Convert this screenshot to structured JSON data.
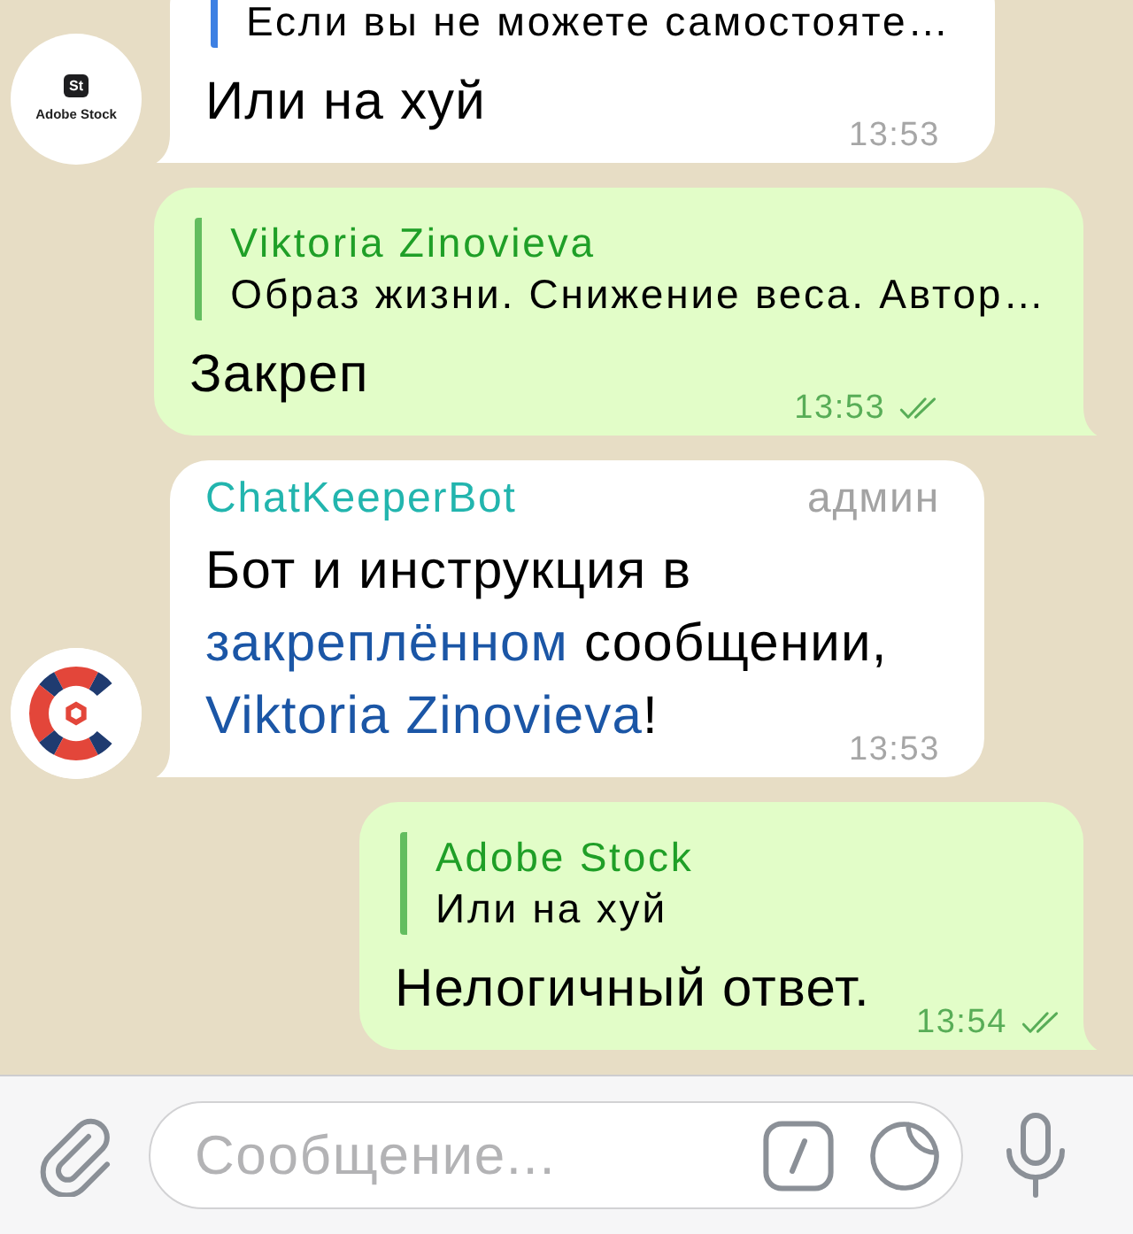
{
  "messages": [
    {
      "kind": "incoming",
      "avatar": {
        "kind": "badge",
        "badge": "St",
        "caption": "Adobe Stock"
      },
      "reply": {
        "text": "Если вы не можете самостояте…"
      },
      "text": [
        {
          "kind": "plain",
          "text": "Или на хуй"
        }
      ],
      "time": "13:53"
    },
    {
      "kind": "outgoing",
      "reply": {
        "name": "Viktoria Zinovieva",
        "text": "Образ жизни. Снижение веса. Автор…"
      },
      "text": [
        {
          "kind": "plain",
          "text": "Закреп"
        }
      ],
      "time": "13:53",
      "read": true
    },
    {
      "kind": "incoming",
      "avatar": {
        "kind": "ring"
      },
      "sender": {
        "name": "ChatKeeperBot",
        "color": "#22b5ae"
      },
      "role": "админ",
      "text": [
        {
          "kind": "plain",
          "text": "Бот и инструкция в "
        },
        {
          "kind": "link",
          "text": "закреплённом"
        },
        {
          "kind": "plain",
          "text": " сообщении, "
        },
        {
          "kind": "link",
          "text": "Viktoria Zinovieva"
        },
        {
          "kind": "plain",
          "text": "!"
        }
      ],
      "time": "13:53"
    },
    {
      "kind": "outgoing",
      "reply": {
        "name": "Adobe Stock",
        "text": "Или на хуй"
      },
      "text": [
        {
          "kind": "plain",
          "text": "Нелогичный ответ."
        }
      ],
      "time": "13:54",
      "read": true
    }
  ],
  "composer": {
    "placeholder": "Сообщение..."
  }
}
